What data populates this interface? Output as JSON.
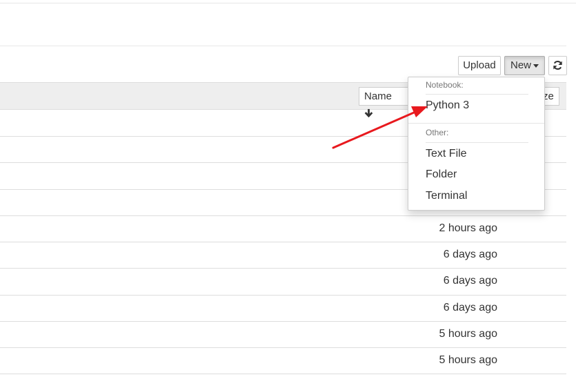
{
  "toolbar": {
    "upload_label": "Upload",
    "new_label": "New",
    "refresh_icon": "refresh-icon"
  },
  "list_header": {
    "sort_name_label": "Name",
    "sort_name_icon": "arrow-down-icon",
    "sort_size_label": "ze"
  },
  "rows": [
    {
      "modified": ""
    },
    {
      "modified": ""
    },
    {
      "modified": ""
    },
    {
      "modified": ""
    },
    {
      "modified": "2 hours ago"
    },
    {
      "modified": "6 days ago"
    },
    {
      "modified": "6 days ago"
    },
    {
      "modified": "6 days ago"
    },
    {
      "modified": "5 hours ago"
    },
    {
      "modified": "5 hours ago"
    }
  ],
  "new_menu": {
    "notebook_header": "Notebook:",
    "python3": "Python 3",
    "other_header": "Other:",
    "text_file": "Text File",
    "folder": "Folder",
    "terminal": "Terminal"
  },
  "annotation": {
    "arrow_color": "#e8191e"
  }
}
